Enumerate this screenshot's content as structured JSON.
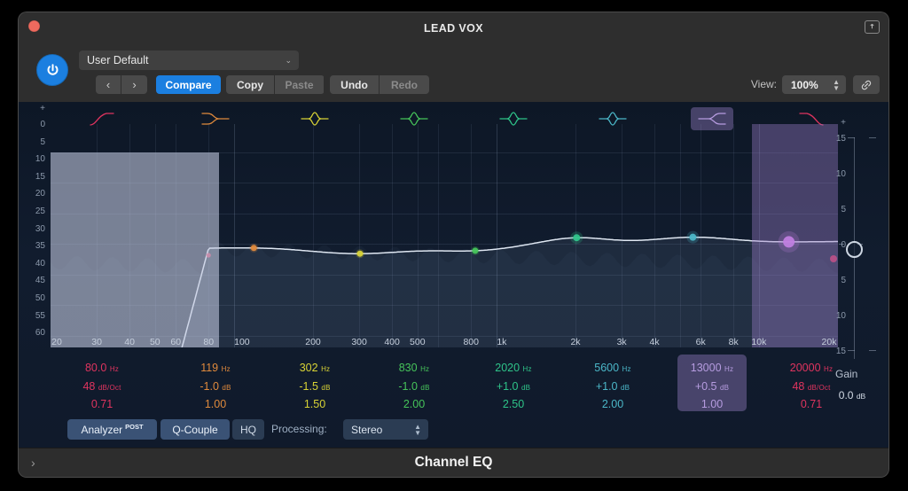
{
  "window": {
    "plugin_title": "LEAD VOX",
    "footer_title": "Channel EQ",
    "close_icon": "close-button",
    "share_icon": "share-export-icon",
    "expand_icon": "chevron-right-icon"
  },
  "toolbar": {
    "power_icon": "power-icon",
    "preset": {
      "value": "User Default",
      "arrow": "⌄"
    },
    "prev_label": "‹",
    "next_label": "›",
    "compare_label": "Compare",
    "copy_label": "Copy",
    "paste_label": "Paste",
    "undo_label": "Undo",
    "redo_label": "Redo",
    "view_label": "View:",
    "view_value": "100%",
    "link_icon": "link-chain-icon"
  },
  "analyzer_scale": {
    "plus": "+",
    "ticks": [
      "0",
      "5",
      "10",
      "15",
      "20",
      "25",
      "30",
      "35",
      "40",
      "45",
      "50",
      "55",
      "60"
    ]
  },
  "gain_slider": {
    "plus": "+",
    "ticks": [
      "15",
      "10",
      "5",
      "0",
      "5",
      "10",
      "15"
    ],
    "label": "Gain",
    "value": "0.0",
    "unit": "dB"
  },
  "frequency_axis": {
    "labels": [
      "20",
      "30",
      "40",
      "50",
      "60",
      "80",
      "100",
      "200",
      "300",
      "400",
      "500",
      "800",
      "1k",
      "2k",
      "3k",
      "4k",
      "6k",
      "8k",
      "10k",
      "20k"
    ]
  },
  "bands": [
    {
      "index": 1,
      "type": "highpass",
      "icon": "highpass-filter-icon",
      "color": "#e0345f",
      "freq": "80.0",
      "freq_unit": "Hz",
      "gain": "48",
      "gain_unit": "dB/Oct",
      "q": "0.71",
      "selected": false
    },
    {
      "index": 2,
      "type": "lowshelf",
      "icon": "low-shelf-filter-icon",
      "color": "#e08a3c",
      "freq": "119",
      "freq_unit": "Hz",
      "gain": "-1.0",
      "gain_unit": "dB",
      "q": "1.00",
      "selected": false
    },
    {
      "index": 3,
      "type": "bell",
      "icon": "bell-filter-icon",
      "color": "#d8d335",
      "freq": "302",
      "freq_unit": "Hz",
      "gain": "-1.5",
      "gain_unit": "dB",
      "q": "1.50",
      "selected": false
    },
    {
      "index": 4,
      "type": "bell",
      "icon": "bell-filter-icon",
      "color": "#46c45a",
      "freq": "830",
      "freq_unit": "Hz",
      "gain": "-1.0",
      "gain_unit": "dB",
      "q": "2.00",
      "selected": false
    },
    {
      "index": 5,
      "type": "bell",
      "icon": "bell-filter-icon",
      "color": "#2ec489",
      "freq": "2020",
      "freq_unit": "Hz",
      "gain": "+1.0",
      "gain_unit": "dB",
      "q": "2.50",
      "selected": false
    },
    {
      "index": 6,
      "type": "bell",
      "icon": "bell-filter-icon",
      "color": "#4bb7c8",
      "freq": "5600",
      "freq_unit": "Hz",
      "gain": "+1.0",
      "gain_unit": "dB",
      "q": "2.00",
      "selected": false
    },
    {
      "index": 7,
      "type": "highshelf",
      "icon": "high-shelf-filter-icon",
      "color": "#b69ce0",
      "freq": "13000",
      "freq_unit": "Hz",
      "gain": "+0.5",
      "gain_unit": "dB",
      "q": "1.00",
      "selected": true
    },
    {
      "index": 8,
      "type": "lowpass",
      "icon": "lowpass-filter-icon",
      "color": "#e0345f",
      "freq": "20000",
      "freq_unit": "Hz",
      "gain": "48",
      "gain_unit": "dB/Oct",
      "q": "0.71",
      "selected": false
    }
  ],
  "controls": {
    "analyzer_label": "Analyzer",
    "analyzer_mode": "POST",
    "analyzer_on": true,
    "qcouple_label": "Q-Couple",
    "qcouple_on": true,
    "hq_label": "HQ",
    "hq_on": false,
    "processing_label": "Processing:",
    "processing_value": "Stereo"
  }
}
